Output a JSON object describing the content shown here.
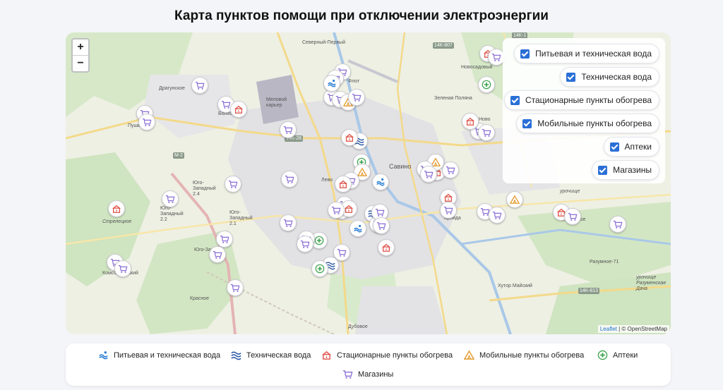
{
  "title": "Карта пунктов помощи при отключении электроэнергии",
  "zoom": {
    "in_label": "+",
    "out_label": "−"
  },
  "layers": [
    {
      "label": "Питьевая и техническая вода",
      "checked": true
    },
    {
      "label": "Техническая вода",
      "checked": true
    },
    {
      "label": "Стационарные пункты обогрева",
      "checked": true
    },
    {
      "label": "Мобильные пункты обогрева",
      "checked": true
    },
    {
      "label": "Аптеки",
      "checked": true
    },
    {
      "label": "Магазины",
      "checked": true
    }
  ],
  "legend": [
    {
      "label": "Питьевая и техническая вода",
      "icon": "drinking-water-icon",
      "color": "#2a7fd4"
    },
    {
      "label": "Техническая вода",
      "icon": "technical-water-icon",
      "color": "#1f4fa0"
    },
    {
      "label": "Стационарные пункты обогрева",
      "icon": "stationary-heating-icon",
      "color": "#e0544a"
    },
    {
      "label": "Мобильные пункты обогрева",
      "icon": "mobile-heating-icon",
      "color": "#e39a2e"
    },
    {
      "label": "Аптеки",
      "icon": "pharmacy-icon",
      "color": "#3aa24a"
    },
    {
      "label": "Магазины",
      "icon": "shop-icon",
      "color": "#8b6fd6"
    }
  ],
  "place_labels": {
    "severny": "Северный-Первый",
    "dragunskoe": "Драгунское",
    "bolkhovets": "Болховец",
    "pushkarnoe": "Пушкарное",
    "melovoy": "Меловой карьер",
    "zelenaya": "Зеленая Поляна",
    "novosadovy": "Новосадовый",
    "savino": "Савино",
    "yugozap24": "Юго-Западный 2.4",
    "yugozap22": "Юго-Западный 2.2",
    "yugozap21": "Юго-Западный 2.1",
    "yugozap": "Юго-Запа",
    "strelecky": "Стрелецкое",
    "komsomolsky": "Комсомольский",
    "krasnoe": "Красное",
    "kreyda": "Крейда",
    "belovskoe": "Беловское",
    "urochishe": "урочище",
    "razumnoe": "Разумное-71",
    "khutor": "Хутор Майский",
    "dubovoe": "Дубовое",
    "razumenskaya": "урочище Разуменская Дача",
    "novo": "Ново",
    "levo": "Лево",
    "fleet": "Флот"
  },
  "road_labels": {
    "r14k807": "14К-807",
    "r14k1": "14К-1",
    "r14k28": "14К-28",
    "rm2": "М-2",
    "r14k813": "14К-813"
  },
  "attribution": {
    "leaflet": "Leaflet",
    "rest": " | © OpenStreetMap"
  },
  "markers": [
    {
      "type": "shop"
    },
    {
      "type": "shop"
    },
    {
      "type": "shop"
    },
    {
      "type": "shop"
    },
    {
      "type": "stationary"
    },
    {
      "type": "shop"
    },
    {
      "type": "shop"
    },
    {
      "type": "shop"
    },
    {
      "type": "shop"
    },
    {
      "type": "drinking"
    },
    {
      "type": "shop"
    },
    {
      "type": "mobile"
    },
    {
      "type": "shop"
    },
    {
      "type": "technical"
    },
    {
      "type": "stationary"
    },
    {
      "type": "pharmacy"
    },
    {
      "type": "mobile"
    },
    {
      "type": "shop"
    },
    {
      "type": "stationary"
    },
    {
      "type": "drinking"
    },
    {
      "type": "shop"
    },
    {
      "type": "stationary"
    },
    {
      "type": "stationary"
    },
    {
      "type": "shop"
    },
    {
      "type": "technical"
    },
    {
      "type": "shop"
    },
    {
      "type": "shop"
    },
    {
      "type": "shop"
    },
    {
      "type": "pharmacy"
    },
    {
      "type": "shop"
    },
    {
      "type": "drinking"
    },
    {
      "type": "shop"
    },
    {
      "type": "stationary"
    },
    {
      "type": "technical"
    },
    {
      "type": "pharmacy"
    },
    {
      "type": "shop"
    },
    {
      "type": "shop"
    },
    {
      "type": "shop"
    },
    {
      "type": "shop"
    },
    {
      "type": "shop"
    },
    {
      "type": "stationary"
    },
    {
      "type": "stationary"
    },
    {
      "type": "shop"
    },
    {
      "type": "shop"
    },
    {
      "type": "mobile"
    },
    {
      "type": "stationary"
    },
    {
      "type": "shop"
    },
    {
      "type": "shop"
    },
    {
      "type": "shop"
    },
    {
      "type": "pharmacy"
    },
    {
      "type": "stationary"
    },
    {
      "type": "shop"
    },
    {
      "type": "stationary"
    },
    {
      "type": "shop"
    },
    {
      "type": "mobile"
    },
    {
      "type": "stationary"
    },
    {
      "type": "shop"
    },
    {
      "type": "shop"
    },
    {
      "type": "shop"
    },
    {
      "type": "shop"
    },
    {
      "type": "shop"
    },
    {
      "type": "shop"
    },
    {
      "type": "shop"
    },
    {
      "type": "shop"
    },
    {
      "type": "shop"
    }
  ]
}
